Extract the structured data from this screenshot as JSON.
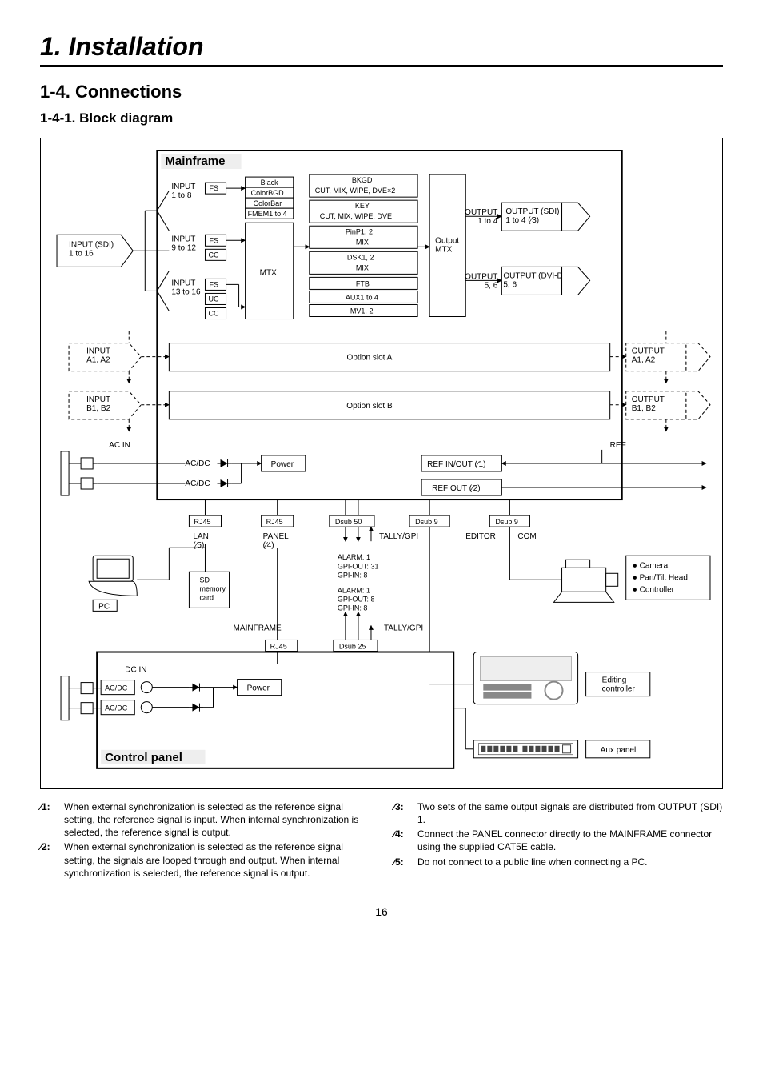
{
  "chapter": "1. Installation",
  "section": "1-4. Connections",
  "subsection": "1-4-1. Block diagram",
  "page_number": "16",
  "diagram": {
    "mainframe_title": "Mainframe",
    "control_panel_title": "Control panel",
    "input_sdi": "INPUT (SDI)\n1 to 16",
    "input_groups": {
      "g1": {
        "label": "INPUT\n1 to 8",
        "tags": [
          "FS"
        ]
      },
      "g2": {
        "label": "INPUT\n9 to 12",
        "tags": [
          "FS",
          "CC"
        ]
      },
      "g3": {
        "label": "INPUT\n13 to 16",
        "tags": [
          "FS",
          "UC",
          "CC"
        ]
      }
    },
    "sources": [
      "Black",
      "ColorBGD",
      "ColorBar",
      "FMEM1 to 4"
    ],
    "mtx": "MTX",
    "processing": {
      "bkgd": {
        "title": "BKGD",
        "sub": "CUT, MIX, WIPE, DVE×2"
      },
      "key": {
        "title": "KEY",
        "sub": "CUT, MIX, WIPE, DVE"
      },
      "pinp": {
        "title": "PinP1, 2",
        "sub": "MIX"
      },
      "dsk": {
        "title": "DSK1, 2",
        "sub": "MIX"
      },
      "ftb": "FTB",
      "aux": "AUX1 to 4",
      "mv": "MV1, 2"
    },
    "output_mtx": "Output\nMTX",
    "outputs": {
      "o1_label": "OUTPUT\n1 to 4",
      "o1_sdi": "OUTPUT (SDI)\n1 to 4 (∕3)",
      "o2_label": "OUTPUT\n5, 6",
      "o2_dvi": "OUTPUT (DVI-D)\n5, 6"
    },
    "option_slot_a": "Option slot A",
    "option_slot_b": "Option slot B",
    "opt_in_a": "INPUT\nA1, A2",
    "opt_out_a": "OUTPUT\nA1, A2",
    "opt_in_b": "INPUT\nB1, B2",
    "opt_out_b": "OUTPUT\nB1, B2",
    "ac_in": "AC IN",
    "acdc": "AC/DC",
    "power": "Power",
    "ref_label": "REF",
    "ref_in_out": "REF IN/OUT (∕1)",
    "ref_out": "REF OUT (∕2)",
    "conn_rj45": "RJ45",
    "conn_dsub50": "Dsub 50",
    "conn_dsub9": "Dsub 9",
    "conn_dsub25": "Dsub 25",
    "lan": "LAN\n(∕5)",
    "panel": "PANEL\n(∕4)",
    "tallygpi": "TALLY/GPI",
    "editor": "EDITOR",
    "com": "COM",
    "alarm1": "ALARM: 1\nGPI-OUT: 31\nGPI-IN: 8",
    "alarm2": "ALARM: 1\nGPI-OUT: 8\nGPI-IN: 8",
    "sd": "SD\nmemory\ncard",
    "pc": "PC",
    "mainframe_conn": "MAINFRAME",
    "dc_in": "DC IN",
    "ext_list": [
      "Camera",
      "Pan/Tilt Head",
      "Controller"
    ],
    "editing_ctrl": "Editing\ncontroller",
    "aux_panel": "Aux panel"
  },
  "footnotes": {
    "n1": {
      "marker": "∕1:",
      "text": "When external synchronization is selected as the reference signal setting, the reference signal is input. When internal synchronization is selected, the reference signal is output."
    },
    "n2": {
      "marker": "∕2:",
      "text": "When external synchronization is selected as the reference signal setting, the signals are looped through and output. When internal synchronization is selected, the reference signal is output."
    },
    "n3": {
      "marker": "∕3:",
      "text": "Two sets of the same output signals are distributed from OUTPUT (SDI) 1."
    },
    "n4": {
      "marker": "∕4:",
      "text": "Connect the PANEL connector directly to the MAINFRAME connector using the supplied CAT5E cable."
    },
    "n5": {
      "marker": "∕5:",
      "text": "Do not connect to a public line when connecting a PC."
    }
  }
}
